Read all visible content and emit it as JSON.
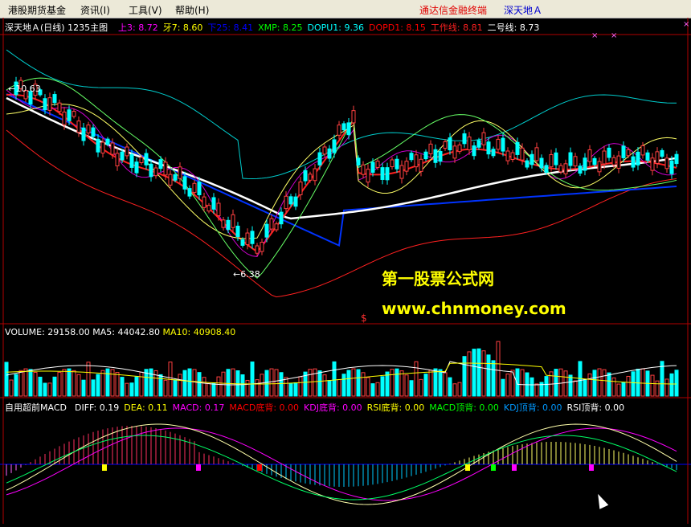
{
  "menu": {
    "items": [
      "港股期货基金",
      "资讯(I)",
      "工具(V)",
      "帮助(H)"
    ],
    "brand": "通达信金融终端",
    "stock_title": "深天地Ａ"
  },
  "main_panel": {
    "title": "深天地Ａ(日线)",
    "indicator_name": "1235主图",
    "values": [
      {
        "label": "上3:",
        "value": "8.72",
        "color": "#ff00ff"
      },
      {
        "label": "牙7:",
        "value": "8.60",
        "color": "#ffff00"
      },
      {
        "label": "下25:",
        "value": "8.41",
        "color": "#0000ff"
      },
      {
        "label": "XMP:",
        "value": "8.25",
        "color": "#00ff00"
      },
      {
        "label": "DOPU1:",
        "value": "9.36",
        "color": "#00ffff"
      },
      {
        "label": "DOPD1:",
        "value": "8.15",
        "color": "#ff0000"
      },
      {
        "label": "工作线:",
        "value": "8.81",
        "color": "#ff2020"
      },
      {
        "label": "二号线:",
        "value": "8.73",
        "color": "#ffffff"
      }
    ],
    "high_label": "10.63",
    "low_label": "6.38"
  },
  "volume_panel": {
    "label": "VOLUME:",
    "value": "29158.00",
    "ma5_label": "MA5:",
    "ma5_value": "44042.80",
    "ma10_label": "MA10:",
    "ma10_value": "40908.40"
  },
  "macd_panel": {
    "title": "自用超前MACD",
    "values": [
      {
        "label": "DIFF:",
        "value": "0.19",
        "color": "#ffffff"
      },
      {
        "label": "DEA:",
        "value": "0.11",
        "color": "#ffff00"
      },
      {
        "label": "MACD:",
        "value": "0.17",
        "color": "#ff00ff"
      },
      {
        "label": "MACD底背:",
        "value": "0.00",
        "color": "#ff0000"
      },
      {
        "label": "KDJ底背:",
        "value": "0.00",
        "color": "#ff00ff"
      },
      {
        "label": "RSI底背:",
        "value": "0.00",
        "color": "#ffff00"
      },
      {
        "label": "MACD顶背:",
        "value": "0.00",
        "color": "#00ff00"
      },
      {
        "label": "KDJ顶背:",
        "value": "0.00",
        "color": "#0099ff"
      },
      {
        "label": "RSI顶背:",
        "value": "0.00",
        "color": "#ffffff"
      }
    ]
  },
  "watermark": {
    "line1": "第一股票公式网",
    "line2": "www.chnmoney.com"
  },
  "marker_symbol": "$",
  "cross_marks": "×"
}
